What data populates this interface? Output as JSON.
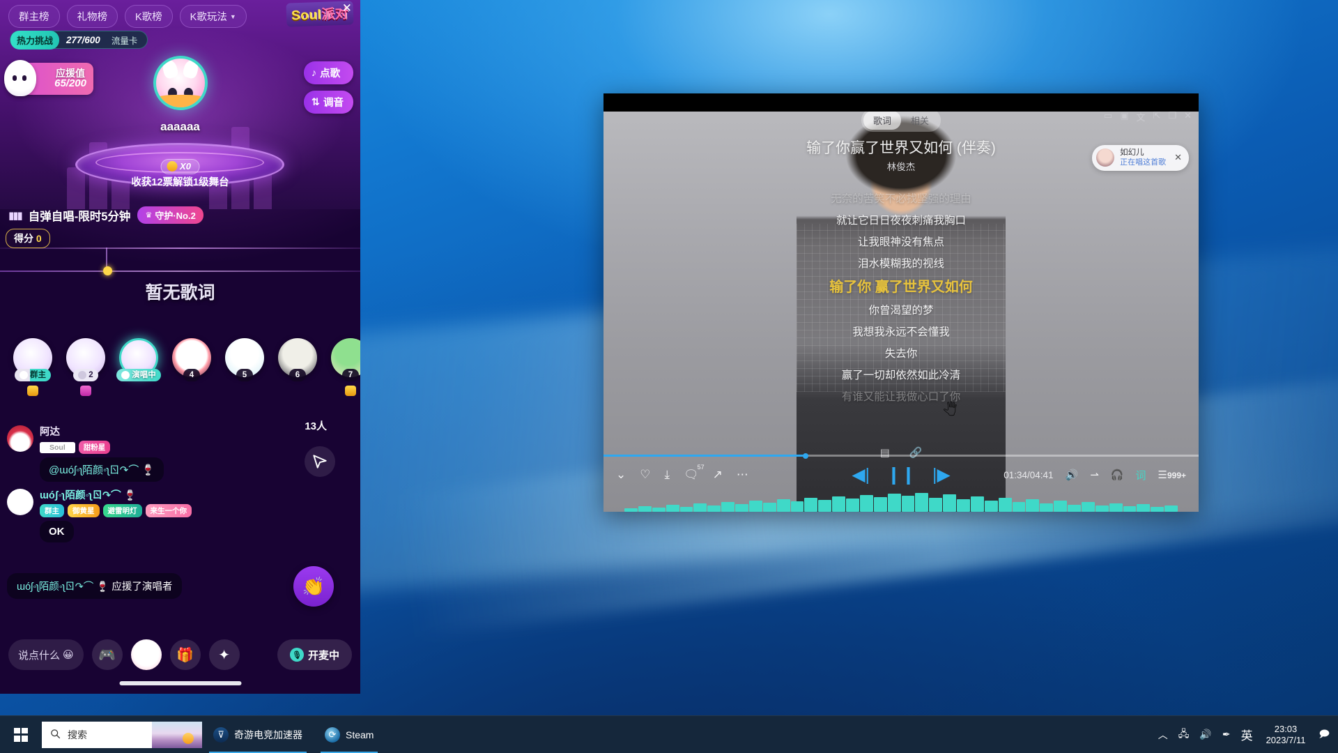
{
  "desktop": {
    "taskbar": {
      "start_label": "start-button",
      "search_placeholder": "搜索",
      "apps": [
        {
          "label": "奇游电竞加速器",
          "icon": "accelerator-icon",
          "active": true
        },
        {
          "label": "Steam",
          "icon": "steam-icon",
          "active": true
        }
      ],
      "tray": {
        "chevron": "︿",
        "network_icon": "network-icon",
        "volume_icon": "volume-icon",
        "pen_icon": "pen-icon",
        "ime_label": "英",
        "time": "23:03",
        "date": "2023/7/11",
        "notification_icon": "notification-icon"
      }
    }
  },
  "cast": {
    "topnav": [
      {
        "label": "群主榜"
      },
      {
        "label": "礼物榜"
      },
      {
        "label": "K歌榜"
      },
      {
        "label": "K歌玩法",
        "caret": "▼"
      }
    ],
    "logo": {
      "latin": "Soul",
      "zh": "派对"
    },
    "close_label": "✕",
    "hot_challenge": {
      "label": "热力挑战",
      "value": "277/600",
      "tag": "流量卡"
    },
    "support": {
      "label": "应援值",
      "value": "65/200"
    },
    "performer": {
      "name": "aaaaaa"
    },
    "stage": {
      "coin_count": "X0",
      "unlock_text": "收获12票解锁1级舞台"
    },
    "side_buttons": [
      {
        "label": "点歌",
        "icon": "music-note-icon"
      },
      {
        "label": "调音",
        "icon": "equalizer-icon"
      }
    ],
    "song_row": {
      "icon": "equalizer-icon",
      "name": "自弹自唱-限时5分钟",
      "guard_tag": "守护·No.2",
      "crown": "♛"
    },
    "score": {
      "label": "得分",
      "value": "0"
    },
    "lyric_placeholder": "暂无歌词",
    "seats": [
      {
        "caption": "群主",
        "type": "owner",
        "mic": true,
        "gem": "gold"
      },
      {
        "caption": "2",
        "type": "numic",
        "mic": true,
        "gem": "pink"
      },
      {
        "caption": "演唱中",
        "type": "sing",
        "mic": true,
        "singing": true
      },
      {
        "caption": "4",
        "type": "num"
      },
      {
        "caption": "5",
        "type": "num"
      },
      {
        "caption": "6",
        "type": "num"
      },
      {
        "caption": "7",
        "type": "num",
        "gem": "gold"
      }
    ],
    "viewer_count": "13人",
    "share_icon": "share-arrow-icon",
    "messages": [
      {
        "name": "阿达",
        "badges": [
          {
            "text": "Soul",
            "style": "soul"
          },
          {
            "text": "甜粉星",
            "style": "pink"
          }
        ],
        "bubble_at": "@ɯóʃ◦ʅ陌颜◦ʅㄖ↷⌒ 🍷"
      },
      {
        "name": "ɯóʃ◦ʅ陌颜◦ʅㄖ↷⌒ 🍷",
        "name_cyan": true,
        "badges": [
          {
            "text": "群主",
            "style": "cyan"
          },
          {
            "text": "御黄星",
            "style": "gold"
          },
          {
            "text": "避雷明灯",
            "style": "green"
          },
          {
            "text": "来生一个你",
            "style": "rose"
          }
        ],
        "bubble": "OK"
      }
    ],
    "system_message": {
      "who": "ɯóʃ◦ʅ陌颜◦ʅㄖ↷⌒ 🍷",
      "action": "应援了演唱者"
    },
    "clap_icon": "clapping-hands-icon",
    "bottom_bar": {
      "say_placeholder": "说点什么",
      "emoji_icon": "smiley-icon",
      "buttons": [
        {
          "icon": "gamepad-icon"
        },
        {
          "icon": "avatar-sticker-icon"
        },
        {
          "icon": "gift-icon"
        },
        {
          "icon": "star-effects-icon"
        }
      ],
      "mic_label": "开麦中",
      "mic_icon": "microphone-icon"
    }
  },
  "player": {
    "tabs": [
      {
        "label": "歌词",
        "active": true
      },
      {
        "label": "相关",
        "active": false
      }
    ],
    "window_controls": [
      "minimize-icon",
      "maximize-icon",
      "translate-icon",
      "pin-icon",
      "restore-icon",
      "close-icon"
    ],
    "song_title": "输了你赢了世界又如何 (伴奏)",
    "artist": "林俊杰",
    "toast": {
      "name": "如幻儿",
      "status": "正在唱这首歌",
      "close": "✕"
    },
    "lyrics": [
      {
        "text": "无奈的苦笑不必找坚强的理由",
        "state": "dim"
      },
      {
        "text": "就让它日日夜夜刺痛我胸口",
        "state": "normal"
      },
      {
        "text": "让我眼神没有焦点",
        "state": "normal"
      },
      {
        "text": "泪水模糊我的视线",
        "state": "normal"
      },
      {
        "text": "输了你 赢了世界又如何",
        "state": "current"
      },
      {
        "text": "你曾渴望的梦",
        "state": "normal"
      },
      {
        "text": "我想我永远不会懂我",
        "state": "normal"
      },
      {
        "text": "失去你",
        "state": "normal"
      },
      {
        "text": "赢了一切却依然如此冷清",
        "state": "normal"
      },
      {
        "text": "有谁又能让我做心口了你",
        "state": "dim"
      }
    ],
    "mini_icons": [
      "phone-icon",
      "link-icon"
    ],
    "controls": {
      "left_icons": [
        "chevron-down-icon",
        "heart-icon",
        "download-icon",
        "comment-icon",
        "share-icon",
        "more-icon"
      ],
      "comment_count": "57",
      "prev_icon": "previous-icon",
      "play_pause_icon": "pause-icon",
      "next_icon": "next-icon",
      "time": "01:34/04:41",
      "right_icons": [
        "volume-icon",
        "loop-icon",
        "headphone-icon",
        "karaoke-icon",
        "playlist-icon"
      ],
      "playlist_count": "999+"
    },
    "progress_percent": 33.5
  }
}
